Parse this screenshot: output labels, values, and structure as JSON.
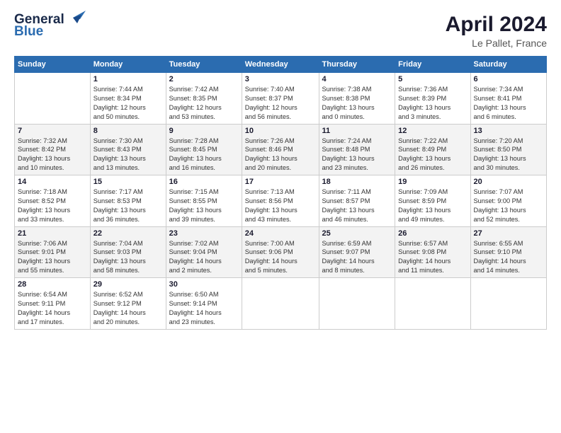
{
  "header": {
    "logo_line1": "General",
    "logo_line2": "Blue",
    "title": "April 2024",
    "subtitle": "Le Pallet, France"
  },
  "calendar": {
    "days_of_week": [
      "Sunday",
      "Monday",
      "Tuesday",
      "Wednesday",
      "Thursday",
      "Friday",
      "Saturday"
    ],
    "weeks": [
      [
        {
          "num": "",
          "info": ""
        },
        {
          "num": "1",
          "info": "Sunrise: 7:44 AM\nSunset: 8:34 PM\nDaylight: 12 hours\nand 50 minutes."
        },
        {
          "num": "2",
          "info": "Sunrise: 7:42 AM\nSunset: 8:35 PM\nDaylight: 12 hours\nand 53 minutes."
        },
        {
          "num": "3",
          "info": "Sunrise: 7:40 AM\nSunset: 8:37 PM\nDaylight: 12 hours\nand 56 minutes."
        },
        {
          "num": "4",
          "info": "Sunrise: 7:38 AM\nSunset: 8:38 PM\nDaylight: 13 hours\nand 0 minutes."
        },
        {
          "num": "5",
          "info": "Sunrise: 7:36 AM\nSunset: 8:39 PM\nDaylight: 13 hours\nand 3 minutes."
        },
        {
          "num": "6",
          "info": "Sunrise: 7:34 AM\nSunset: 8:41 PM\nDaylight: 13 hours\nand 6 minutes."
        }
      ],
      [
        {
          "num": "7",
          "info": "Sunrise: 7:32 AM\nSunset: 8:42 PM\nDaylight: 13 hours\nand 10 minutes."
        },
        {
          "num": "8",
          "info": "Sunrise: 7:30 AM\nSunset: 8:43 PM\nDaylight: 13 hours\nand 13 minutes."
        },
        {
          "num": "9",
          "info": "Sunrise: 7:28 AM\nSunset: 8:45 PM\nDaylight: 13 hours\nand 16 minutes."
        },
        {
          "num": "10",
          "info": "Sunrise: 7:26 AM\nSunset: 8:46 PM\nDaylight: 13 hours\nand 20 minutes."
        },
        {
          "num": "11",
          "info": "Sunrise: 7:24 AM\nSunset: 8:48 PM\nDaylight: 13 hours\nand 23 minutes."
        },
        {
          "num": "12",
          "info": "Sunrise: 7:22 AM\nSunset: 8:49 PM\nDaylight: 13 hours\nand 26 minutes."
        },
        {
          "num": "13",
          "info": "Sunrise: 7:20 AM\nSunset: 8:50 PM\nDaylight: 13 hours\nand 30 minutes."
        }
      ],
      [
        {
          "num": "14",
          "info": "Sunrise: 7:18 AM\nSunset: 8:52 PM\nDaylight: 13 hours\nand 33 minutes."
        },
        {
          "num": "15",
          "info": "Sunrise: 7:17 AM\nSunset: 8:53 PM\nDaylight: 13 hours\nand 36 minutes."
        },
        {
          "num": "16",
          "info": "Sunrise: 7:15 AM\nSunset: 8:55 PM\nDaylight: 13 hours\nand 39 minutes."
        },
        {
          "num": "17",
          "info": "Sunrise: 7:13 AM\nSunset: 8:56 PM\nDaylight: 13 hours\nand 43 minutes."
        },
        {
          "num": "18",
          "info": "Sunrise: 7:11 AM\nSunset: 8:57 PM\nDaylight: 13 hours\nand 46 minutes."
        },
        {
          "num": "19",
          "info": "Sunrise: 7:09 AM\nSunset: 8:59 PM\nDaylight: 13 hours\nand 49 minutes."
        },
        {
          "num": "20",
          "info": "Sunrise: 7:07 AM\nSunset: 9:00 PM\nDaylight: 13 hours\nand 52 minutes."
        }
      ],
      [
        {
          "num": "21",
          "info": "Sunrise: 7:06 AM\nSunset: 9:01 PM\nDaylight: 13 hours\nand 55 minutes."
        },
        {
          "num": "22",
          "info": "Sunrise: 7:04 AM\nSunset: 9:03 PM\nDaylight: 13 hours\nand 58 minutes."
        },
        {
          "num": "23",
          "info": "Sunrise: 7:02 AM\nSunset: 9:04 PM\nDaylight: 14 hours\nand 2 minutes."
        },
        {
          "num": "24",
          "info": "Sunrise: 7:00 AM\nSunset: 9:06 PM\nDaylight: 14 hours\nand 5 minutes."
        },
        {
          "num": "25",
          "info": "Sunrise: 6:59 AM\nSunset: 9:07 PM\nDaylight: 14 hours\nand 8 minutes."
        },
        {
          "num": "26",
          "info": "Sunrise: 6:57 AM\nSunset: 9:08 PM\nDaylight: 14 hours\nand 11 minutes."
        },
        {
          "num": "27",
          "info": "Sunrise: 6:55 AM\nSunset: 9:10 PM\nDaylight: 14 hours\nand 14 minutes."
        }
      ],
      [
        {
          "num": "28",
          "info": "Sunrise: 6:54 AM\nSunset: 9:11 PM\nDaylight: 14 hours\nand 17 minutes."
        },
        {
          "num": "29",
          "info": "Sunrise: 6:52 AM\nSunset: 9:12 PM\nDaylight: 14 hours\nand 20 minutes."
        },
        {
          "num": "30",
          "info": "Sunrise: 6:50 AM\nSunset: 9:14 PM\nDaylight: 14 hours\nand 23 minutes."
        },
        {
          "num": "",
          "info": ""
        },
        {
          "num": "",
          "info": ""
        },
        {
          "num": "",
          "info": ""
        },
        {
          "num": "",
          "info": ""
        }
      ]
    ]
  }
}
